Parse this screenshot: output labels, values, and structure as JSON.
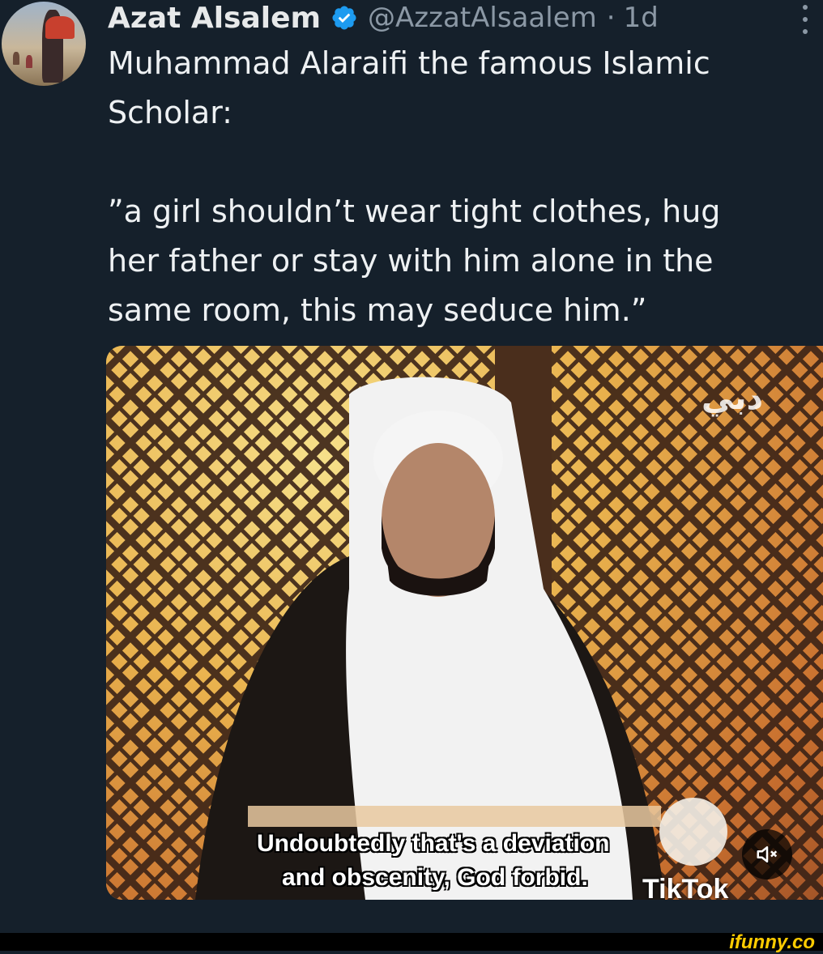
{
  "tweet": {
    "author_name": "Azat Alsalem",
    "author_handle": "@AzzatAlsaalem",
    "separator": "·",
    "time_ago": "1d",
    "text_line1": "Muhammad Alaraifi the famous Islamic",
    "text_line2": "Scholar:",
    "quote_line1": "”a girl shouldn’t wear tight clothes, hug",
    "quote_line2": "her father or stay with him alone in the",
    "quote_line3": "same room, this may seduce him.”"
  },
  "video": {
    "subtitle_line1": "Undoubtedly that's a deviation",
    "subtitle_line2": "and obscenity, God forbid.",
    "watermark": "TikTok",
    "muted": true
  },
  "footer": {
    "ifunny_logo": "ifunny.co"
  },
  "colors": {
    "background": "#15202b",
    "verified_badge": "#1d9bf0",
    "handle_gray": "#8b98a5",
    "ifunny_yellow": "#ffcc00"
  },
  "icons": [
    "verified-badge-icon",
    "more-options-icon",
    "mute-icon"
  ]
}
